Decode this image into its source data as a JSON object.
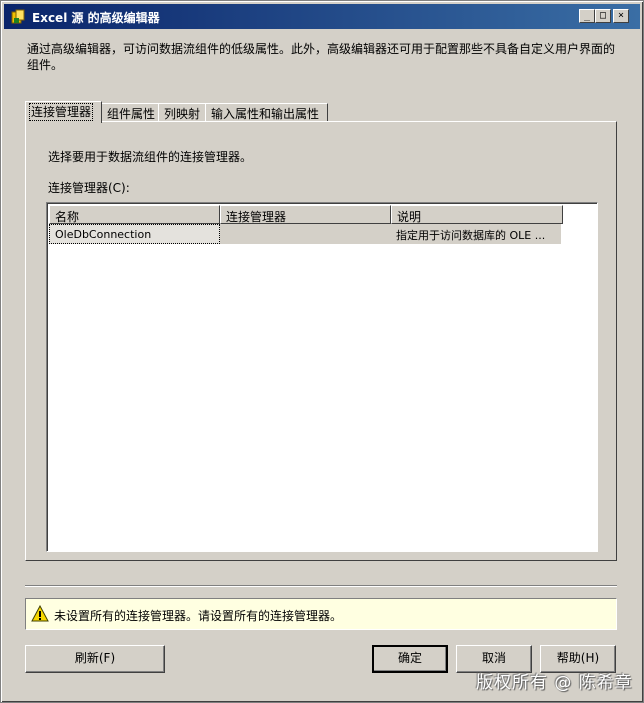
{
  "window": {
    "title": "Excel 源 的高级编辑器",
    "controls": {
      "minimize": "_",
      "maximize": "□",
      "close": "×"
    }
  },
  "description": "通过高级编辑器，可访问数据流组件的低级属性。此外，高级编辑器还可用于配置那些不具备自定义用户界面的组件。",
  "tabs": [
    {
      "label": "连接管理器",
      "active": true
    },
    {
      "label": "组件属性"
    },
    {
      "label": "列映射"
    },
    {
      "label": "输入属性和输出属性"
    }
  ],
  "panel": {
    "hint": "选择要用于数据流组件的连接管理器。",
    "list_label": "连接管理器(C):",
    "columns": [
      "名称",
      "连接管理器",
      "说明"
    ],
    "rows": [
      {
        "name": "OleDbConnection",
        "manager": "",
        "description": "指定用于访问数据库的 OLE ..."
      }
    ]
  },
  "status": {
    "icon": "warning-icon",
    "message": "未设置所有的连接管理器。请设置所有的连接管理器。"
  },
  "buttons": {
    "refresh": "刷新(F)",
    "ok": "确定",
    "cancel": "取消",
    "help": "帮助(H)"
  },
  "watermark": "版权所有 @ 陈希章",
  "colors": {
    "titlebar_start": "#0a246a",
    "titlebar_end": "#3a6ea5",
    "face": "#d4d0c8",
    "status_bg": "#ffffe1"
  }
}
